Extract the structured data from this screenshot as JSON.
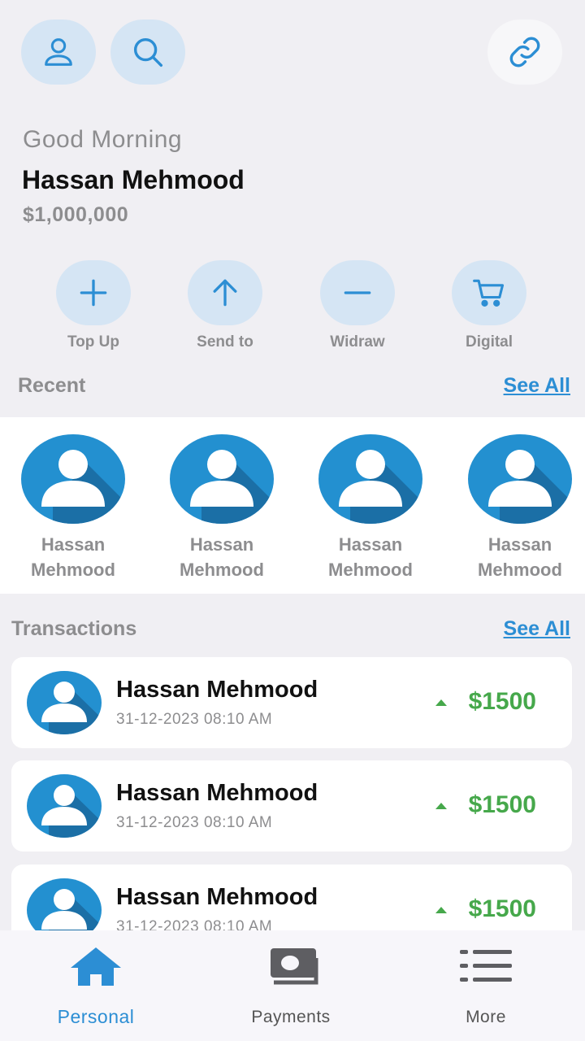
{
  "header": {
    "greeting": "Good Morning",
    "user_name": "Hassan Mehmood",
    "balance": "$1,000,000"
  },
  "quick_actions": [
    {
      "label": "Top Up",
      "icon": "plus-icon"
    },
    {
      "label": "Send to",
      "icon": "arrow-up-icon"
    },
    {
      "label": "Widraw",
      "icon": "minus-icon"
    },
    {
      "label": "Digital",
      "icon": "cart-icon"
    }
  ],
  "recent": {
    "title": "Recent",
    "see_all": "See All",
    "contacts": [
      {
        "first": "Hassan",
        "last": "Mehmood"
      },
      {
        "first": "Hassan",
        "last": "Mehmood"
      },
      {
        "first": "Hassan",
        "last": "Mehmood"
      },
      {
        "first": "Hassan",
        "last": "Mehmood"
      }
    ]
  },
  "transactions": {
    "title": "Transactions",
    "see_all": "See All",
    "items": [
      {
        "name": "Hassan Mehmood",
        "date": "31-12-2023 08:10 AM",
        "amount": "$1500",
        "direction": "up"
      },
      {
        "name": "Hassan Mehmood",
        "date": "31-12-2023 08:10 AM",
        "amount": "$1500",
        "direction": "up"
      },
      {
        "name": "Hassan Mehmood",
        "date": "31-12-2023 08:10 AM",
        "amount": "$1500",
        "direction": "up"
      }
    ]
  },
  "bottom_nav": [
    {
      "label": "Personal",
      "icon": "home-icon",
      "active": true
    },
    {
      "label": "Payments",
      "icon": "payments-icon",
      "active": false
    },
    {
      "label": "More",
      "icon": "menu-list-icon",
      "active": false
    }
  ],
  "colors": {
    "accent": "#2c8ed4",
    "icon_bg": "#d5e5f4",
    "positive": "#46a84b",
    "avatar": "#2390d0"
  }
}
